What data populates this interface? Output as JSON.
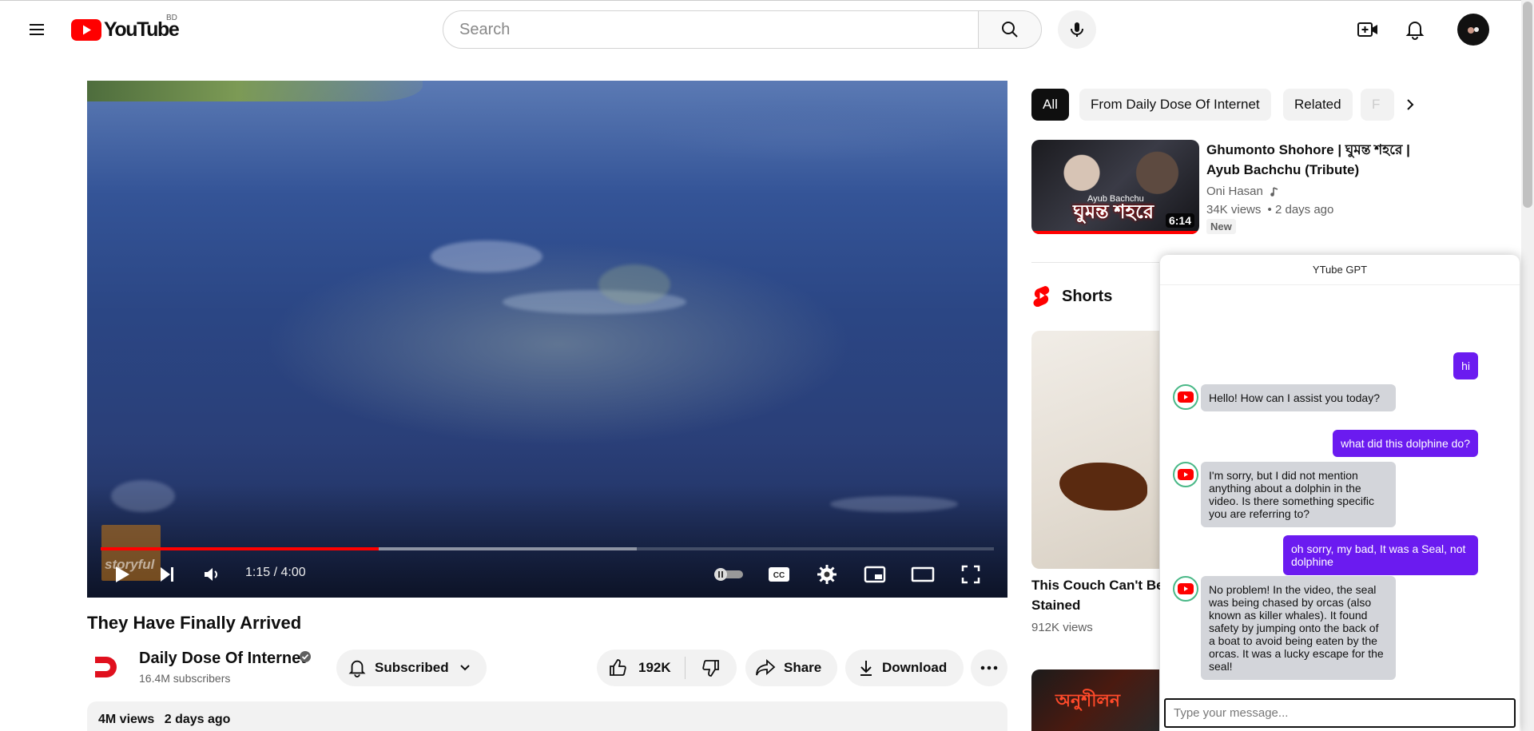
{
  "header": {
    "logo_text": "YouTube",
    "country_code": "BD",
    "search_placeholder": "Search"
  },
  "player": {
    "watermark": "storyful",
    "time_display": "1:15 / 4:00",
    "progress_played_fraction": 0.311,
    "progress_buffered_fraction": 0.6
  },
  "video": {
    "title": "They Have Finally Arrived",
    "channel_name": "Daily Dose Of Internet",
    "subscribers": "16.4M subscribers",
    "subscribe_label": "Subscribed",
    "like_count": "192K",
    "share_label": "Share",
    "download_label": "Download",
    "views": "4M views",
    "age": "2 days ago"
  },
  "chips": [
    {
      "label": "All"
    },
    {
      "label": "From Daily Dose Of Internet"
    },
    {
      "label": "Related"
    },
    {
      "label": "F"
    }
  ],
  "recommendations": [
    {
      "title": "Ghumonto Shohore | ঘুমন্ত শহরে | Ayub Bachchu (Tribute)",
      "channel": "Oni Hasan",
      "views": "34K views",
      "age": "• 2 days ago",
      "badge": "New",
      "duration": "6:14",
      "thumb_text": "ঘুমন্ত শহরে",
      "thumb_subtext": "Ayub Bachchu"
    }
  ],
  "shorts": {
    "section_title": "Shorts",
    "items": [
      {
        "title": "This Couch Can't Be Stained",
        "views": "912K views"
      }
    ],
    "next_thumb_text": "অনুশীলন"
  },
  "chat": {
    "title": "YTube GPT",
    "input_placeholder": "Type your message...",
    "messages": [
      {
        "role": "user",
        "text": "hi"
      },
      {
        "role": "bot",
        "text": "Hello! How can I assist you today?"
      },
      {
        "role": "user",
        "text": "what did this dolphine do?"
      },
      {
        "role": "bot",
        "text": "I'm sorry, but I did not mention anything about a dolphin in the video. Is there something specific you are referring to?"
      },
      {
        "role": "user",
        "text": "oh sorry, my bad, It was a Seal, not dolphine"
      },
      {
        "role": "bot",
        "text": "No problem! In the video, the seal was being chased by orcas (also known as killer whales). It found safety by jumping onto the back of a boat to avoid being eaten by the orcas. It was a lucky escape for the seal!"
      }
    ]
  },
  "colors": {
    "brand_red": "#ff0000",
    "chat_user_bubble": "#6b1bf0",
    "chat_bot_bubble": "#d3d5da"
  }
}
